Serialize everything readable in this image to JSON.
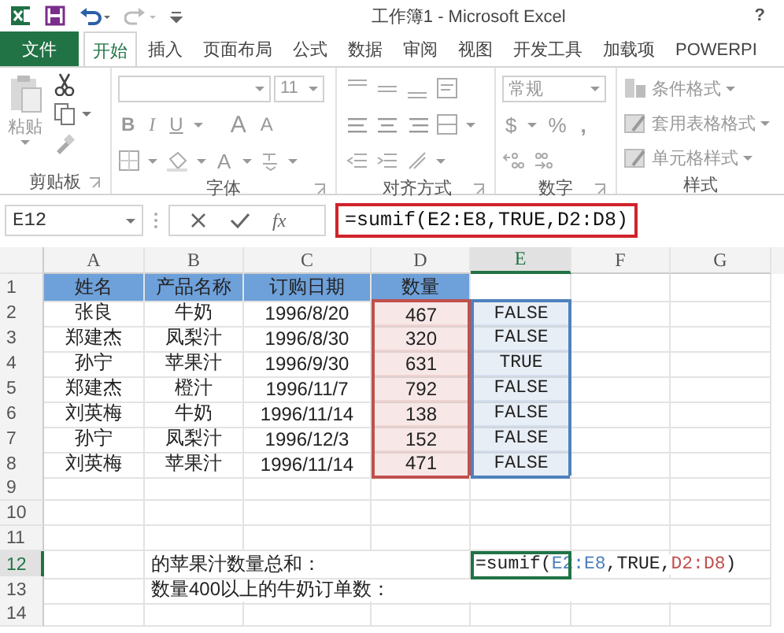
{
  "title_bar": {
    "title": "工作簿1 - Microsoft Excel",
    "help": "?"
  },
  "ribbon_tabs": [
    {
      "label": "文件",
      "kind": "file",
      "selected": false
    },
    {
      "label": "开始",
      "kind": "tab",
      "selected": true
    },
    {
      "label": "插入",
      "kind": "tab",
      "selected": false
    },
    {
      "label": "页面布局",
      "kind": "tab",
      "selected": false
    },
    {
      "label": "公式",
      "kind": "tab",
      "selected": false
    },
    {
      "label": "数据",
      "kind": "tab",
      "selected": false
    },
    {
      "label": "审阅",
      "kind": "tab",
      "selected": false
    },
    {
      "label": "视图",
      "kind": "tab",
      "selected": false
    },
    {
      "label": "开发工具",
      "kind": "tab",
      "selected": false
    },
    {
      "label": "加载项",
      "kind": "tab",
      "selected": false
    },
    {
      "label": "POWERPI",
      "kind": "tab",
      "selected": false
    }
  ],
  "ribbon_groups": [
    {
      "kind": "clipboard",
      "label": "剪贴板",
      "paste": "粘贴"
    },
    {
      "kind": "font",
      "label": "字体",
      "font_size": "11",
      "bold": "B",
      "italic": "I",
      "underline": "U",
      "grow": "A",
      "shrink": "A",
      "font_color": "A"
    },
    {
      "kind": "alignment",
      "label": "对齐方式"
    },
    {
      "kind": "number",
      "label": "数字",
      "format": "常规",
      "currency": "$",
      "percent": "%",
      "comma": ","
    },
    {
      "kind": "styles",
      "label": "样式",
      "buttons": [
        "条件格式",
        "套用表格格式",
        "单元格样式"
      ]
    }
  ],
  "formula_bar": {
    "name_box": "E12",
    "fx": "fx",
    "formula": "=sumif(E2:E8,TRUE,D2:D8)"
  },
  "sheet": {
    "columns": [
      {
        "label": "A",
        "selected": false
      },
      {
        "label": "B",
        "selected": false
      },
      {
        "label": "C",
        "selected": false
      },
      {
        "label": "D",
        "selected": false
      },
      {
        "label": "E",
        "selected": true
      },
      {
        "label": "F",
        "selected": false
      },
      {
        "label": "G",
        "selected": false
      }
    ],
    "rows": [
      {
        "label": "1",
        "selected": false,
        "cells": [
          {
            "kind": "header",
            "text": "姓名"
          },
          {
            "kind": "header",
            "text": "产品名称"
          },
          {
            "kind": "header",
            "text": "订购日期"
          },
          {
            "kind": "header",
            "text": "数量"
          }
        ]
      },
      {
        "label": "2",
        "selected": false,
        "cells": [
          {
            "text": "张良"
          },
          {
            "text": "牛奶"
          },
          {
            "text": "1996/8/20"
          },
          {
            "text": "467",
            "color": "#c0504d"
          },
          {
            "text": "FALSE",
            "color": "#4f81bd"
          }
        ]
      },
      {
        "label": "3",
        "selected": false,
        "cells": [
          {
            "text": "郑建杰"
          },
          {
            "text": "凤梨汁"
          },
          {
            "text": "1996/8/30"
          },
          {
            "text": "320",
            "color": "#c0504d"
          },
          {
            "text": "FALSE",
            "color": "#4f81bd"
          }
        ]
      },
      {
        "label": "4",
        "selected": false,
        "cells": [
          {
            "text": "孙宁"
          },
          {
            "text": "苹果汁"
          },
          {
            "text": "1996/9/30"
          },
          {
            "text": "631",
            "color": "#c0504d"
          },
          {
            "text": "TRUE",
            "color": "#4f81bd"
          }
        ]
      },
      {
        "label": "5",
        "selected": false,
        "cells": [
          {
            "text": "郑建杰"
          },
          {
            "text": "橙汁"
          },
          {
            "text": "1996/11/7"
          },
          {
            "text": "792",
            "color": "#c0504d"
          },
          {
            "text": "FALSE",
            "color": "#4f81bd"
          }
        ]
      },
      {
        "label": "6",
        "selected": false,
        "cells": [
          {
            "text": "刘英梅"
          },
          {
            "text": "牛奶"
          },
          {
            "text": "1996/11/14"
          },
          {
            "text": "138",
            "color": "#c0504d"
          },
          {
            "text": "FALSE",
            "color": "#4f81bd"
          }
        ]
      },
      {
        "label": "7",
        "selected": false,
        "cells": [
          {
            "text": "孙宁"
          },
          {
            "text": "凤梨汁"
          },
          {
            "text": "1996/12/3"
          },
          {
            "text": "152",
            "color": "#c0504d"
          },
          {
            "text": "FALSE",
            "color": "#4f81bd"
          }
        ]
      },
      {
        "label": "8",
        "selected": false,
        "cells": [
          {
            "text": "刘英梅"
          },
          {
            "text": "苹果汁"
          },
          {
            "text": "1996/11/14"
          },
          {
            "text": "471",
            "color": "#c0504d"
          },
          {
            "text": "FALSE",
            "color": "#4f81bd"
          }
        ]
      },
      {
        "label": "9",
        "selected": false,
        "cells": []
      },
      {
        "label": "10",
        "selected": false,
        "cells": []
      },
      {
        "label": "11",
        "selected": false,
        "cells": []
      },
      {
        "label": "12",
        "selected": true,
        "cells": [
          {
            "text": ""
          },
          {
            "kind": "label",
            "text": "的苹果汁数量总和："
          },
          {
            "text": ""
          },
          {
            "text": ""
          },
          {
            "kind": "formula",
            "active": true,
            "segments": [
              {
                "text": "=sumif("
              },
              {
                "text": "E2:E8",
                "color": "#4f81bd"
              },
              {
                "text": ",TRUE,"
              },
              {
                "text": "D2:D8",
                "color": "#c0504d"
              },
              {
                "text": ")"
              }
            ]
          }
        ]
      },
      {
        "label": "13",
        "selected": false,
        "cells": [
          {
            "text": ""
          },
          {
            "kind": "label",
            "text": "数量400以上的牛奶订单数："
          }
        ]
      },
      {
        "label": "14",
        "selected": false,
        "cells": []
      }
    ]
  }
}
